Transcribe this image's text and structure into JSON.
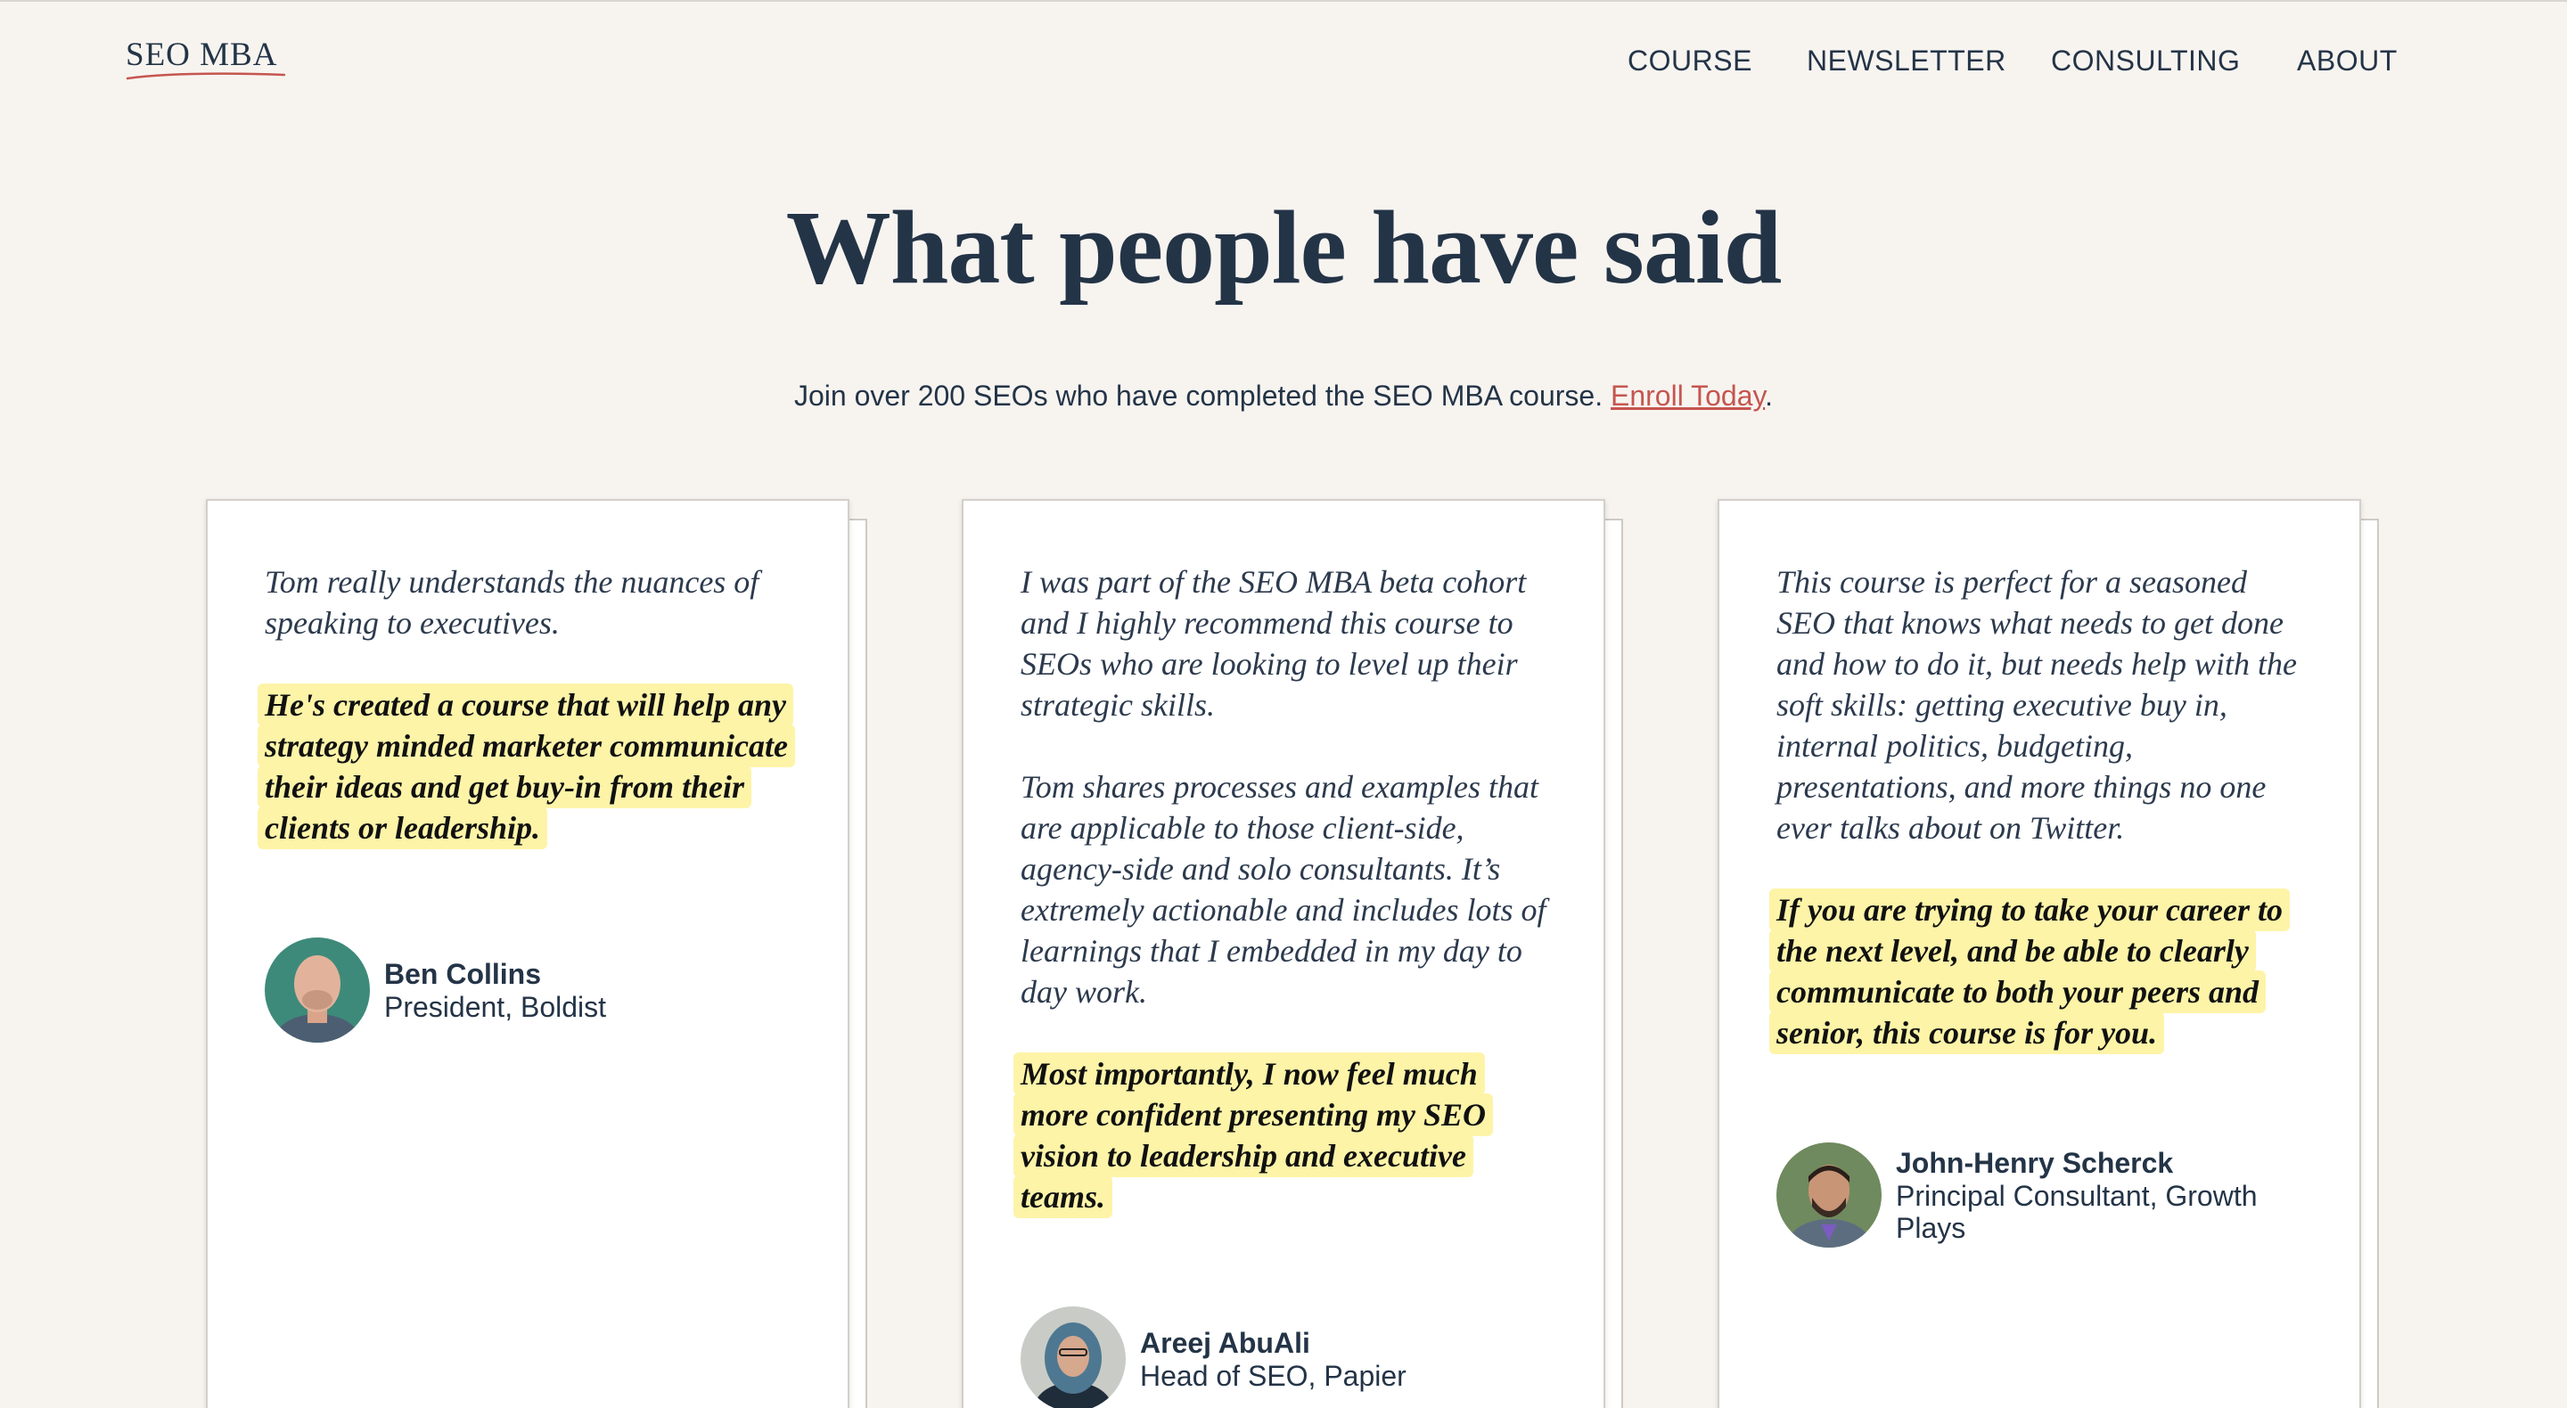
{
  "header": {
    "logo_text": "SEO MBA",
    "nav": [
      {
        "label": "COURSE"
      },
      {
        "label": "NEWSLETTER"
      },
      {
        "label": "CONSULTING"
      },
      {
        "label": "ABOUT"
      }
    ]
  },
  "hero": {
    "title": "What people have said",
    "subtitle": "Join over 200 SEOs who have completed the SEO MBA course.",
    "cta_link": "Enroll Today",
    "cta_suffix": "."
  },
  "testimonials": [
    {
      "paragraphs": [
        "Tom really understands the nuances of speaking to executives."
      ],
      "highlight": "He's created a course that will help any strategy minded marketer communicate their ideas and get buy-in from their clients or leadership.",
      "name": "Ben Collins",
      "role": "President, Boldist"
    },
    {
      "paragraphs": [
        "I was part of the SEO MBA beta cohort and I highly recommend this course to SEOs who are looking to level up their strategic skills.",
        "Tom shares processes and examples that are applicable to those client-side, agency-side and solo consultants. It’s extremely actionable and includes lots of learnings that I embedded in my day to day work."
      ],
      "highlight": "Most importantly, I now feel much more confident presenting my SEO vision to leadership and executive teams.",
      "name": "Areej AbuAli",
      "role": "Head of SEO, Papier"
    },
    {
      "paragraphs": [
        "This course is perfect for a seasoned SEO that knows what needs to get done and how to do it, but needs help with the soft skills: getting executive buy in, internal politics, budgeting, presentations, and more things no one ever talks about on Twitter."
      ],
      "highlight": "If you are trying to take your career to the next level, and be able to clearly communicate to both your peers and senior, this course is for you.",
      "name": "John-Henry Scherck",
      "role": "Principal Consultant, Growth Plays"
    }
  ],
  "colors": {
    "background": "#f7f4f0",
    "text": "#243447",
    "link": "#c5564f",
    "highlight": "#fdf4a8"
  }
}
